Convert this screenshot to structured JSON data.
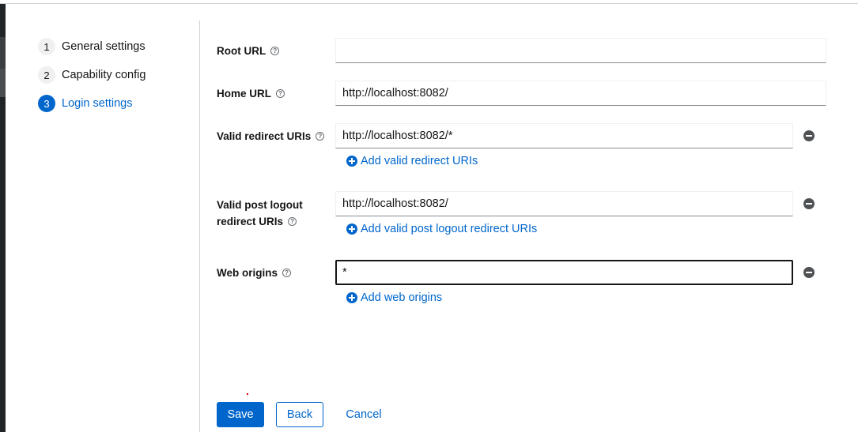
{
  "wizard": {
    "steps": [
      {
        "number": "1",
        "label": "General settings"
      },
      {
        "number": "2",
        "label": "Capability config"
      },
      {
        "number": "3",
        "label": "Login settings"
      }
    ],
    "current_step": 3
  },
  "form": {
    "root_url": {
      "label": "Root URL",
      "value": ""
    },
    "home_url": {
      "label": "Home URL",
      "value": "http://localhost:8082/"
    },
    "valid_redirect_uris": {
      "label": "Valid redirect URIs",
      "value": "http://localhost:8082/*",
      "add_label": "Add valid redirect URIs"
    },
    "valid_post_logout": {
      "label_line1": "Valid post logout",
      "label_line2": "redirect URIs",
      "value": "http://localhost:8082/",
      "add_label": "Add valid post logout redirect URIs"
    },
    "web_origins": {
      "label": "Web origins",
      "value": "*",
      "add_label": "Add web origins"
    },
    "help_glyph": "?"
  },
  "actions": {
    "save": "Save",
    "back": "Back",
    "cancel": "Cancel"
  },
  "colors": {
    "accent": "#0066cc",
    "text": "#151515",
    "remove_icon": "#4f5255"
  }
}
